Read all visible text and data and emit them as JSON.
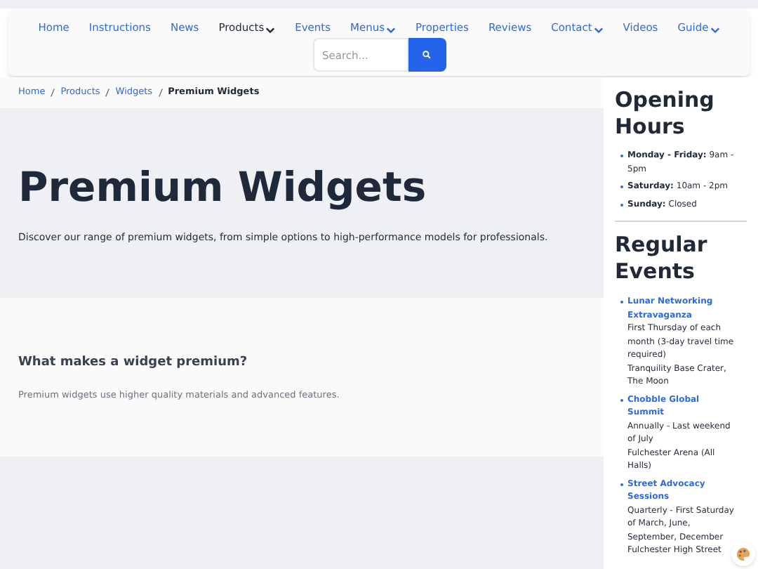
{
  "nav": {
    "items": [
      {
        "label": "Home",
        "selected": false,
        "dropdown": false
      },
      {
        "label": "Instructions",
        "selected": false,
        "dropdown": false
      },
      {
        "label": "News",
        "selected": false,
        "dropdown": false
      },
      {
        "label": "Products",
        "selected": true,
        "dropdown": true
      },
      {
        "label": "Events",
        "selected": false,
        "dropdown": false
      },
      {
        "label": "Menus",
        "selected": false,
        "dropdown": true
      },
      {
        "label": "Properties",
        "selected": false,
        "dropdown": false
      },
      {
        "label": "Reviews",
        "selected": false,
        "dropdown": false
      },
      {
        "label": "Contact",
        "selected": false,
        "dropdown": true
      },
      {
        "label": "Videos",
        "selected": false,
        "dropdown": false
      },
      {
        "label": "Guide",
        "selected": false,
        "dropdown": true
      }
    ],
    "search": {
      "placeholder": "Search..."
    }
  },
  "breadcrumb": [
    {
      "label": "Home",
      "current": false
    },
    {
      "label": "Products",
      "current": false
    },
    {
      "label": "Widgets",
      "current": false
    },
    {
      "label": "Premium Widgets",
      "current": true
    }
  ],
  "hero": {
    "title": "Premium Widgets",
    "subtitle": "Discover our range of premium widgets, from simple options to high-performance models for professionals."
  },
  "section": {
    "heading": "What makes a widget premium?",
    "text": "Premium widgets use higher quality materials and advanced features."
  },
  "sidebar": {
    "hours": {
      "title": "Opening Hours",
      "items": [
        {
          "day": "Monday - Friday:",
          "time": "9am - 5pm"
        },
        {
          "day": "Saturday:",
          "time": "10am - 2pm"
        },
        {
          "day": "Sunday:",
          "time": "Closed"
        }
      ]
    },
    "events": {
      "title": "Regular Events",
      "items": [
        {
          "name": "Lunar Networking Extravaganza",
          "when": "First Thursday of each month (3-day travel time required)",
          "where": "Tranquility Base Crater, The Moon"
        },
        {
          "name": "Chobble Global Summit",
          "when": "Annually - Last weekend of July",
          "where": "Fulchester Arena (All Halls)"
        },
        {
          "name": "Street Advocacy Sessions",
          "when": "Quarterly - First Saturday of March, June, September, December",
          "where": "Fulchester High Street"
        }
      ]
    }
  }
}
